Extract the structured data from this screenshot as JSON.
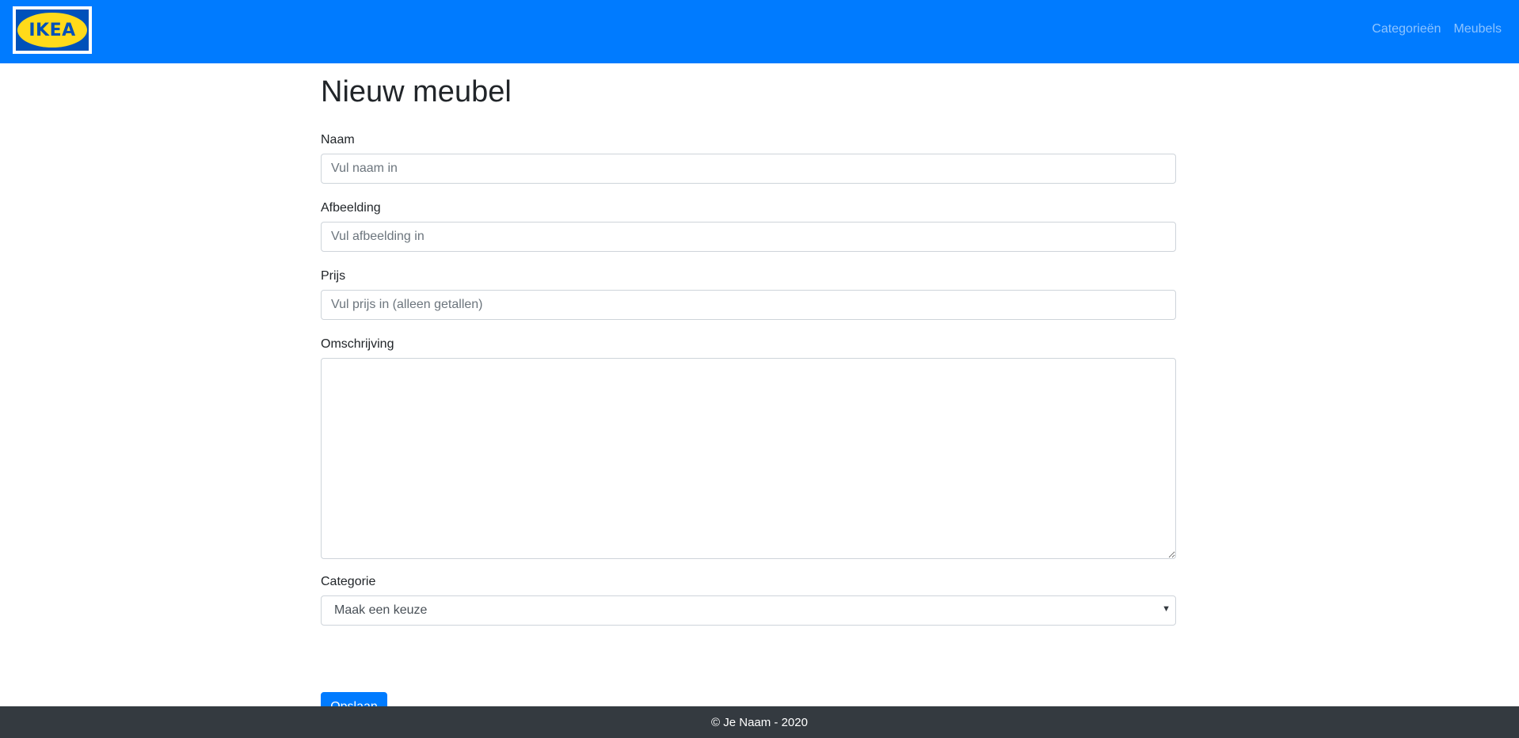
{
  "navbar": {
    "logo_text": "IKEA",
    "links": [
      {
        "label": "Categorieën"
      },
      {
        "label": "Meubels"
      }
    ],
    "colors": {
      "background": "#007bff",
      "link": "rgba(255,255,255,0.55)"
    }
  },
  "page": {
    "title": "Nieuw meubel"
  },
  "form": {
    "naam": {
      "label": "Naam",
      "value": "",
      "placeholder": "Vul naam in"
    },
    "afbeelding": {
      "label": "Afbeelding",
      "value": "",
      "placeholder": "Vul afbeelding in"
    },
    "prijs": {
      "label": "Prijs",
      "value": "",
      "placeholder": "Vul prijs in (alleen getallen)"
    },
    "omschrijving": {
      "label": "Omschrijving",
      "value": ""
    },
    "categorie": {
      "label": "Categorie",
      "selected": "Maak een keuze"
    },
    "submit_label": "Opslaan"
  },
  "footer": {
    "text": "© Je Naam - 2020",
    "background": "#343a40"
  }
}
